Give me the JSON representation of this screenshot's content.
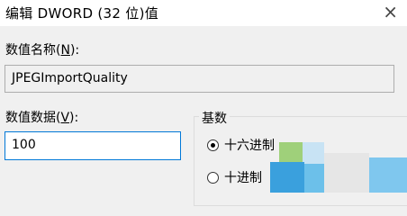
{
  "window": {
    "title": "编辑 DWORD (32 位)值",
    "close_glyph": "×"
  },
  "value_name": {
    "label_pre": "数值名称(",
    "label_accel": "N",
    "label_post": "):",
    "value": "JPEGImportQuality"
  },
  "value_data": {
    "label_pre": "数值数据(",
    "label_accel": "V",
    "label_post": "):",
    "value": "100"
  },
  "base": {
    "title": "基数",
    "options": [
      {
        "label": "十六进制",
        "selected": true
      },
      {
        "label": "十进制",
        "selected": false
      }
    ]
  },
  "colors": {
    "focus_border": "#0078d7",
    "dialog_bg": "#f0f0f0"
  }
}
